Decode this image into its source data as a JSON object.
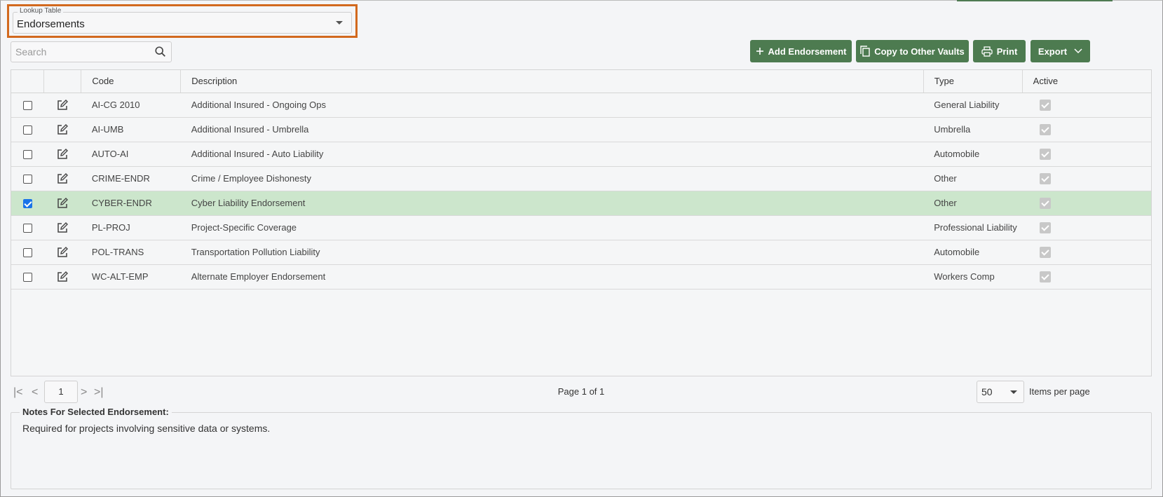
{
  "lookup": {
    "label": "Lookup Table",
    "value": "Endorsements"
  },
  "search": {
    "placeholder": "Search"
  },
  "toolbar": {
    "add_label": "Add Endorsement",
    "copy_label": "Copy to Other Vaults",
    "print_label": "Print",
    "export_label": "Export"
  },
  "table": {
    "headers": [
      "",
      "",
      "Code",
      "Description",
      "Type",
      "Active"
    ],
    "rows": [
      {
        "checked": false,
        "code": "AI-CG 2010",
        "description": "Additional Insured - Ongoing Ops",
        "type": "General Liability",
        "active": true
      },
      {
        "checked": false,
        "code": "AI-UMB",
        "description": "Additional Insured - Umbrella",
        "type": "Umbrella",
        "active": true
      },
      {
        "checked": false,
        "code": "AUTO-AI",
        "description": "Additional Insured - Auto Liability",
        "type": "Automobile",
        "active": true
      },
      {
        "checked": false,
        "code": "CRIME-ENDR",
        "description": "Crime / Employee Dishonesty",
        "type": "Other",
        "active": true
      },
      {
        "checked": true,
        "code": "CYBER-ENDR",
        "description": "Cyber Liability Endorsement",
        "type": "Other",
        "active": true
      },
      {
        "checked": false,
        "code": "PL-PROJ",
        "description": "Project-Specific Coverage",
        "type": "Professional Liability",
        "active": true
      },
      {
        "checked": false,
        "code": "POL-TRANS",
        "description": "Transportation Pollution Liability",
        "type": "Automobile",
        "active": true
      },
      {
        "checked": false,
        "code": "WC-ALT-EMP",
        "description": "Alternate Employer Endorsement",
        "type": "Workers Comp",
        "active": true
      }
    ]
  },
  "pager": {
    "current_page": "1",
    "page_info": "Page 1 of 1",
    "items_per_page_value": "50",
    "items_per_page_label": "Items per page"
  },
  "notes": {
    "title": "Notes For Selected Endorsement:",
    "text": "Required for projects involving sensitive data or systems."
  },
  "colors": {
    "primary_button": "#4d7b50",
    "selected_row": "#cce6cc",
    "highlight_border": "#d2691e"
  }
}
